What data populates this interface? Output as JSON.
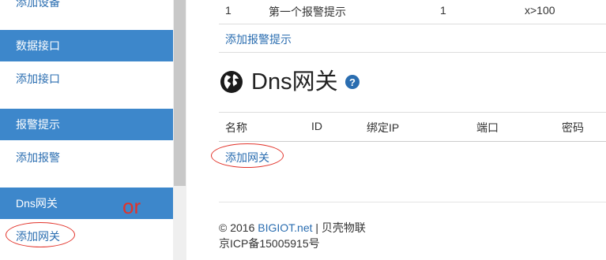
{
  "sidebar": {
    "top_partial_label": "添加设备",
    "sections": [
      {
        "title": "数据接口",
        "item": "添加接口"
      },
      {
        "title": "报警提示",
        "item": "添加报警"
      },
      {
        "title": "Dns网关",
        "item": "添加网关"
      }
    ]
  },
  "alarm_table": {
    "row": [
      "1",
      "第一个报警提示",
      "1",
      "x>100"
    ],
    "add_link": "添加报警提示"
  },
  "dns_section": {
    "title": "Dns网关",
    "columns": [
      "名称",
      "ID",
      "绑定IP",
      "端口",
      "密码"
    ],
    "add_link": "添加网关"
  },
  "annotation": {
    "or_text": "or",
    "color": "#e2332a"
  },
  "footer": {
    "copyright_prefix": "© 2016 ",
    "brand": "BIGIOT.net",
    "separator_suffix": " | 贝壳物联",
    "icp": "京ICP备15005915号"
  },
  "colors": {
    "accent": "#3d87cb",
    "link": "#2a6db0"
  }
}
